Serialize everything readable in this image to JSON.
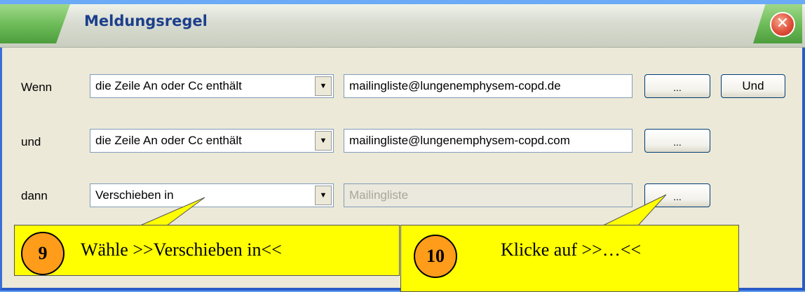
{
  "window": {
    "title": "Meldungsregel",
    "close_glyph": "✕"
  },
  "rows": [
    {
      "label": "Wenn",
      "condition": "die Zeile An oder Cc enthält",
      "value": "mailingliste@lungenemphysem-copd.de",
      "browse_label": "...",
      "add_label": "Und"
    },
    {
      "label": "und",
      "condition": "die Zeile An oder Cc enthält",
      "value": "mailingliste@lungenemphysem-copd.com",
      "browse_label": "..."
    },
    {
      "label": "dann",
      "action": "Verschieben in",
      "value": "Mailingliste",
      "value_disabled": true,
      "browse_label": "..."
    }
  ],
  "dropdown_glyph": "▼",
  "callouts": [
    {
      "number": "9",
      "text": "Wähle >>Verschieben in<<",
      "color": "#ffff00",
      "badge_color": "#ff9c1a"
    },
    {
      "number": "10",
      "text": "Klicke auf >>…<<",
      "color": "#ffff00",
      "badge_color": "#ff9c1a"
    }
  ],
  "icons": {
    "dropdown": "chevron-down-icon",
    "close": "close-icon"
  }
}
